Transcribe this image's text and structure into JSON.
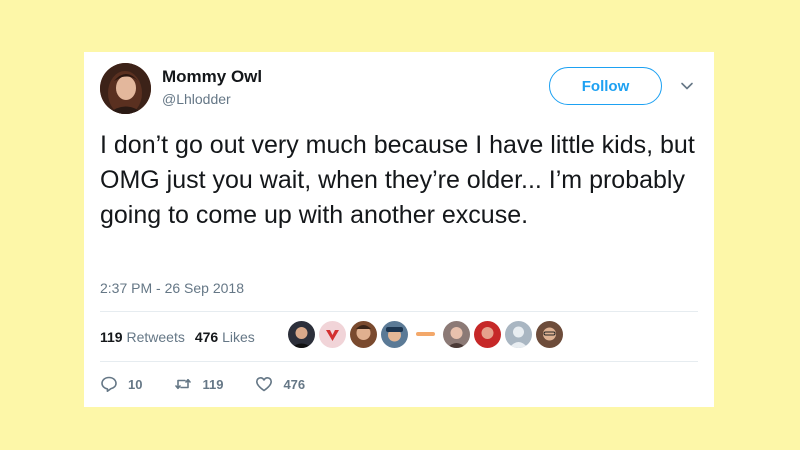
{
  "tweet": {
    "author_name": "Mommy Owl",
    "author_handle": "@Lhlodder",
    "follow_label": "Follow",
    "text": "I don’t go out very much because I have little kids, but OMG just you wait, when they’re older... I’m probably going to come up with another excuse.",
    "timestamp": "2:37 PM - 26 Sep 2018",
    "retweets_count": "119",
    "retweets_label": "Retweets",
    "likes_count": "476",
    "likes_label": "Likes",
    "reply_count": "10",
    "retweet_action_count": "119",
    "like_action_count": "476"
  },
  "likers": [
    {
      "icon": "avatar-dark-hair",
      "color": "#2c2f3a"
    },
    {
      "icon": "avatar-logo-red",
      "color": "#f1d4d8"
    },
    {
      "icon": "avatar-man",
      "color": "#7a4a2e"
    },
    {
      "icon": "avatar-cap",
      "color": "#5b7a96"
    },
    {
      "icon": "avatar-logo-text",
      "color": "#f3a86a"
    },
    {
      "icon": "avatar-woman",
      "color": "#8c7a76"
    },
    {
      "icon": "avatar-red",
      "color": "#c62828"
    },
    {
      "icon": "avatar-default",
      "color": "#a9b6c2"
    },
    {
      "icon": "avatar-glasses",
      "color": "#6d4c3a"
    }
  ],
  "colors": {
    "background": "#fdf7a8",
    "accent": "#1da1f2",
    "text": "#14171a",
    "muted": "#657786"
  }
}
